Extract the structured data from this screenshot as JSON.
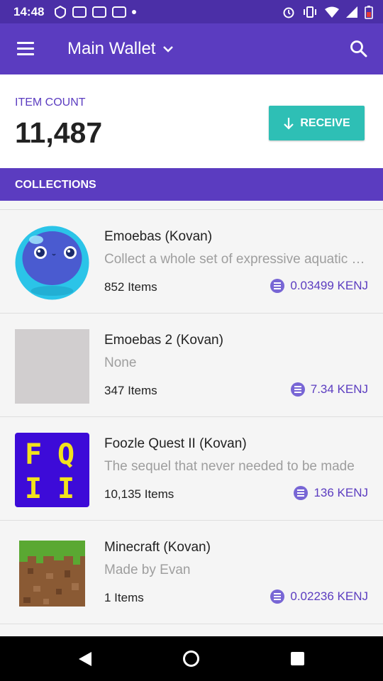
{
  "status_bar": {
    "time": "14:48"
  },
  "app_bar": {
    "title": "Main Wallet"
  },
  "summary": {
    "count_label": "ITEM COUNT",
    "count_value": "11,487",
    "receive_label": "RECEIVE"
  },
  "collections_header": "COLLECTIONS",
  "collections": [
    {
      "title": "Emoebas (Kovan)",
      "description": "Collect a whole set of expressive aquatic creatures",
      "count": "852 Items",
      "price": "0.03499 KENJ",
      "thumb": "emoeba"
    },
    {
      "title": "Emoebas 2 (Kovan)",
      "description": "None",
      "count": "347 Items",
      "price": "7.34 KENJ",
      "thumb": "placeholder"
    },
    {
      "title": "Foozle Quest II (Kovan)",
      "description": "The sequel that never needed to be made",
      "count": "10,135 Items",
      "price": "136 KENJ",
      "thumb": "fq-logo",
      "thumb_text": [
        "F",
        "Q",
        "I",
        "I"
      ]
    },
    {
      "title": "Minecraft (Kovan)",
      "description": "Made by Evan",
      "count": "1 Items",
      "price": "0.02236 KENJ",
      "thumb": "grass-block"
    }
  ],
  "colors": {
    "primary": "#5b3cc0",
    "status": "#4b2fa7",
    "accent": "#2ebfb5",
    "enj": "#7866d5"
  }
}
